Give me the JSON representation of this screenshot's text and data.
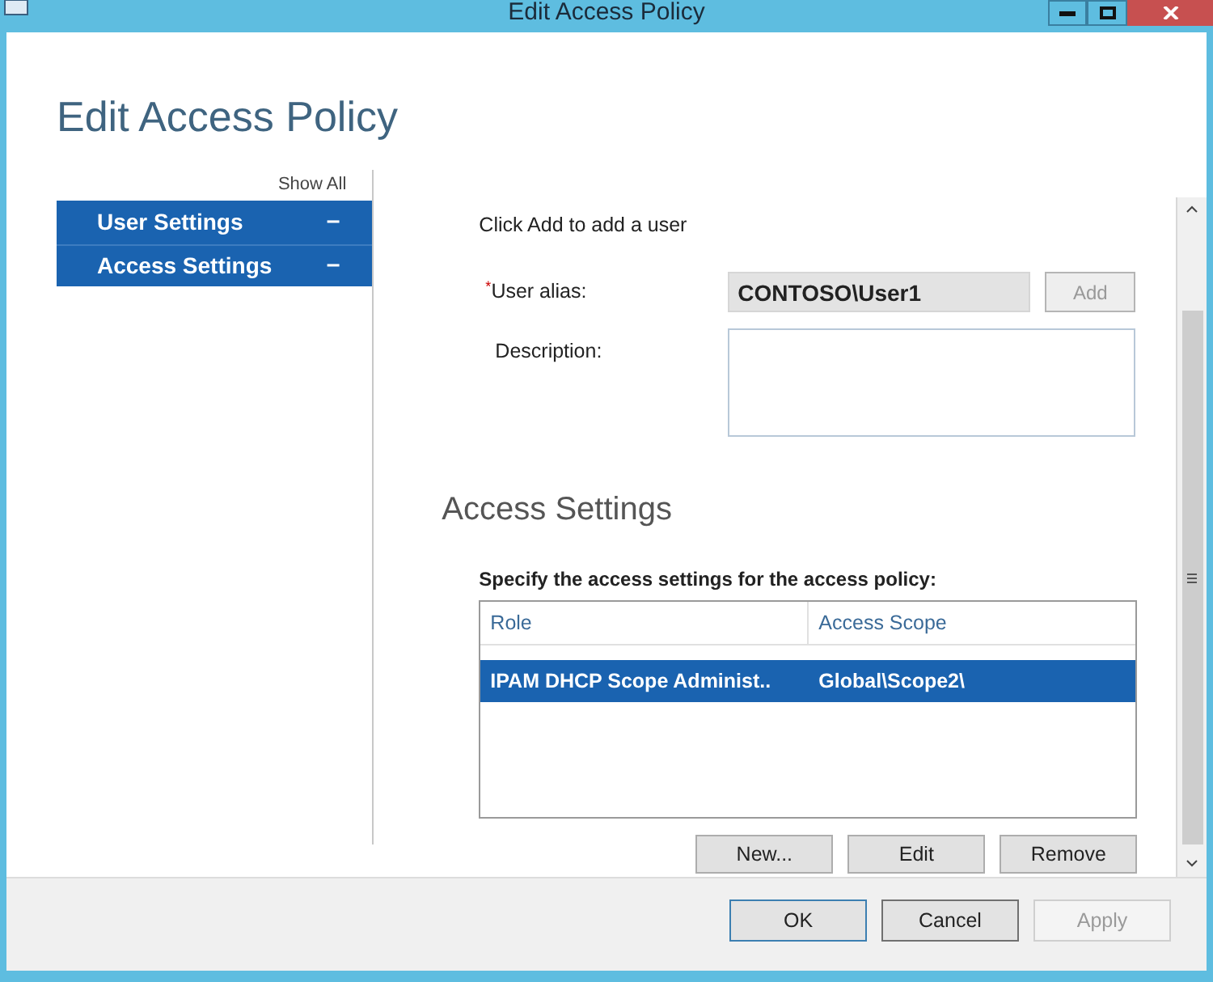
{
  "window": {
    "title": "Edit Access Policy"
  },
  "page_title": "Edit Access Policy",
  "nav": {
    "show_all": "Show All",
    "items": [
      {
        "label": "User Settings",
        "toggle": "–"
      },
      {
        "label": "Access Settings",
        "toggle": "–"
      }
    ]
  },
  "user_section": {
    "hint": "Click Add to add a user",
    "required_mark": "*",
    "alias_label": "User alias:",
    "alias_value": "CONTOSO\\User1",
    "add_button": "Add",
    "description_label": "Description:"
  },
  "access_section": {
    "heading": "Access Settings",
    "hint": "Specify the access settings for the access policy:",
    "columns": [
      "Role",
      "Access Scope"
    ],
    "rows": [
      {
        "cells": [
          "IPAM DHCP Scope Administ..",
          "Global\\Scope2\\"
        ],
        "selected": true
      }
    ],
    "buttons": [
      "New...",
      "Edit",
      "Remove"
    ]
  },
  "footer": {
    "buttons": [
      {
        "label": "OK",
        "default": true,
        "disabled": false
      },
      {
        "label": "Cancel",
        "default": false,
        "disabled": false
      },
      {
        "label": "Apply",
        "default": false,
        "disabled": true
      }
    ]
  }
}
